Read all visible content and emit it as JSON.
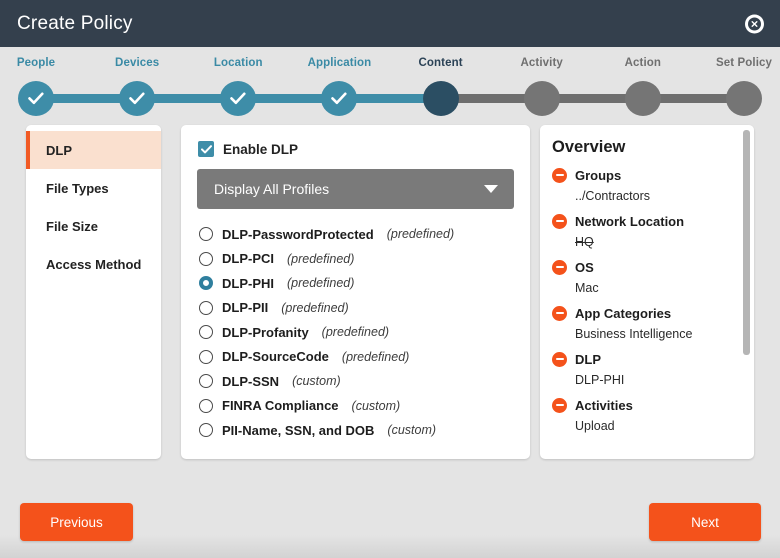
{
  "window": {
    "title": "Create Policy",
    "close_icon": "close-icon"
  },
  "stepper": {
    "steps": [
      {
        "label": "People",
        "state": "done"
      },
      {
        "label": "Devices",
        "state": "done"
      },
      {
        "label": "Location",
        "state": "done"
      },
      {
        "label": "Application",
        "state": "done"
      },
      {
        "label": "Content",
        "state": "current"
      },
      {
        "label": "Activity",
        "state": "todo"
      },
      {
        "label": "Action",
        "state": "todo"
      },
      {
        "label": "Set Policy",
        "state": "todo"
      }
    ],
    "colors": {
      "done": "#3e8da8",
      "current": "#2b4e63",
      "todo": "#757575"
    }
  },
  "sidebar": {
    "items": [
      {
        "label": "DLP",
        "active": true
      },
      {
        "label": "File Types",
        "active": false
      },
      {
        "label": "File Size",
        "active": false
      },
      {
        "label": "Access Method",
        "active": false
      }
    ],
    "accent": "#f15a24",
    "active_bg": "#fae0cf"
  },
  "main": {
    "enable_dlp_label": "Enable DLP",
    "enable_dlp_checked": true,
    "profile_select_value": "Display All Profiles",
    "profiles": [
      {
        "name": "DLP-PasswordProtected",
        "kind": "(predefined)",
        "selected": false
      },
      {
        "name": "DLP-PCI",
        "kind": "(predefined)",
        "selected": false
      },
      {
        "name": "DLP-PHI",
        "kind": "(predefined)",
        "selected": true
      },
      {
        "name": "DLP-PII",
        "kind": "(predefined)",
        "selected": false
      },
      {
        "name": "DLP-Profanity",
        "kind": "(predefined)",
        "selected": false
      },
      {
        "name": "DLP-SourceCode",
        "kind": "(predefined)",
        "selected": false
      },
      {
        "name": "DLP-SSN",
        "kind": "(custom)",
        "selected": false
      },
      {
        "name": "FINRA Compliance",
        "kind": "(custom)",
        "selected": false
      },
      {
        "name": "PII-Name, SSN, and DOB",
        "kind": "(custom)",
        "selected": false
      }
    ]
  },
  "overview": {
    "title": "Overview",
    "items": [
      {
        "label": "Groups",
        "value": "../Contractors",
        "struck": false
      },
      {
        "label": "Network Location",
        "value": "HQ",
        "struck": true
      },
      {
        "label": "OS",
        "value": "Mac",
        "struck": false
      },
      {
        "label": "App Categories",
        "value": "Business Intelligence",
        "struck": false
      },
      {
        "label": "DLP",
        "value": "DLP-PHI",
        "struck": false
      },
      {
        "label": "Activities",
        "value": "Upload",
        "struck": false
      }
    ],
    "remove_icon": "minus-circle-icon"
  },
  "footer": {
    "previous_label": "Previous",
    "next_label": "Next",
    "button_color": "#f4521b"
  }
}
